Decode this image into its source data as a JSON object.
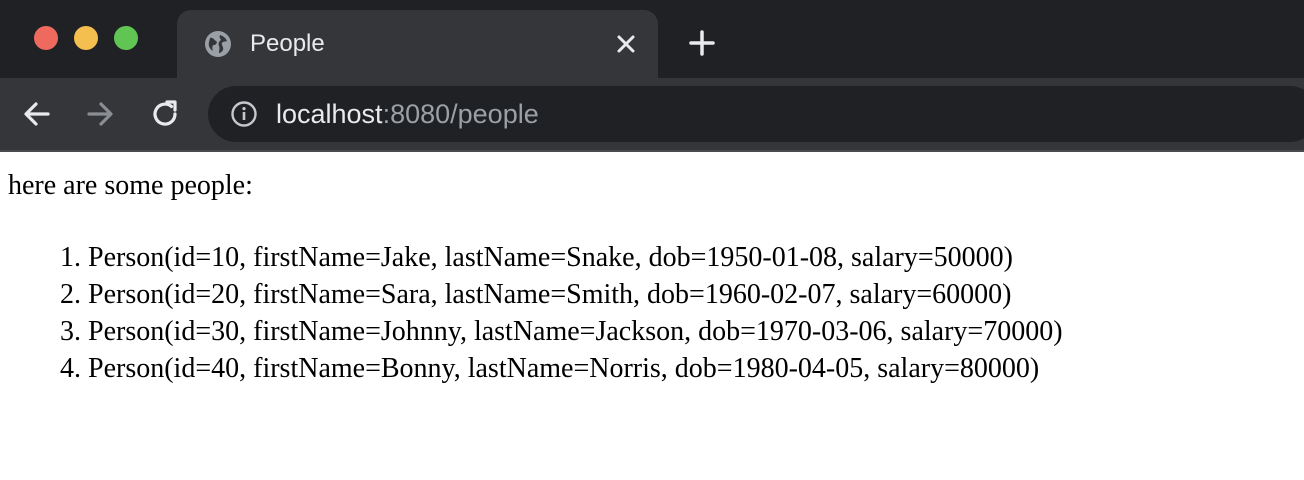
{
  "browser": {
    "tab": {
      "title": "People",
      "favicon": "globe-icon"
    },
    "address": {
      "host": "localhost",
      "rest": ":8080/people"
    },
    "colors": {
      "close": "#ee6a5e",
      "minimize": "#f5bf4f",
      "zoom": "#61c554",
      "titlebar": "#202124",
      "toolbar": "#35363a"
    }
  },
  "page": {
    "intro": "here are some people:",
    "people": [
      {
        "text": "Person(id=10, firstName=Jake, lastName=Snake, dob=1950-01-08, salary=50000)"
      },
      {
        "text": "Person(id=20, firstName=Sara, lastName=Smith, dob=1960-02-07, salary=60000)"
      },
      {
        "text": "Person(id=30, firstName=Johnny, lastName=Jackson, dob=1970-03-06, salary=70000)"
      },
      {
        "text": "Person(id=40, firstName=Bonny, lastName=Norris, dob=1980-04-05, salary=80000)"
      }
    ]
  }
}
